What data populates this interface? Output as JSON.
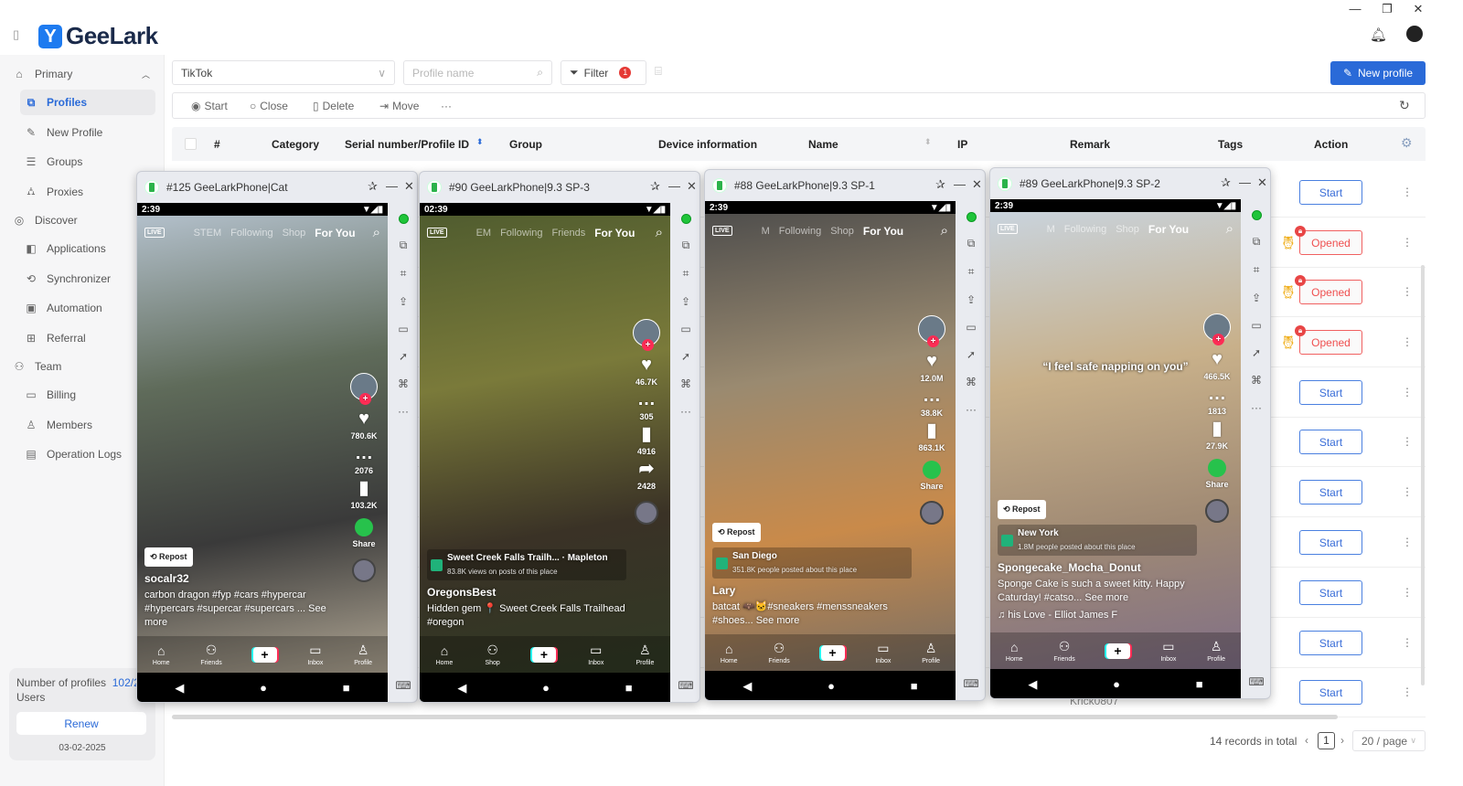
{
  "app": {
    "name": "GeeLark",
    "window_controls": [
      "—",
      "❐",
      "✕"
    ]
  },
  "sidebar": {
    "groups": [
      {
        "label": "Primary",
        "icon": "home-icon",
        "items": [
          {
            "label": "Profiles",
            "icon": "profiles-icon",
            "active": true
          },
          {
            "label": "New Profile",
            "icon": "edit-icon"
          },
          {
            "label": "Groups",
            "icon": "list-icon"
          },
          {
            "label": "Proxies",
            "icon": "proxy-icon"
          }
        ]
      },
      {
        "label": "Discover",
        "icon": "planet-icon",
        "items": [
          {
            "label": "Applications",
            "icon": "apps-icon"
          },
          {
            "label": "Synchronizer",
            "icon": "sync-icon"
          },
          {
            "label": "Automation",
            "icon": "robot-icon"
          },
          {
            "label": "Referral",
            "icon": "gift-icon"
          }
        ]
      },
      {
        "label": "Team",
        "icon": "team-icon",
        "items": [
          {
            "label": "Billing",
            "icon": "wallet-icon"
          },
          {
            "label": "Members",
            "icon": "member-icon"
          },
          {
            "label": "Operation Logs",
            "icon": "log-icon"
          }
        ]
      }
    ],
    "plan": {
      "profiles_label": "Number of profiles",
      "profiles_value": "102/2",
      "users_label": "Users",
      "renew": "Renew",
      "date": "03-02-2025"
    }
  },
  "toolbar": {
    "platform": "TikTok",
    "search_placeholder": "Profile name",
    "filter": "Filter",
    "filter_count": "1",
    "new_profile": "New profile"
  },
  "actions": [
    "Start",
    "Close",
    "Delete",
    "Move",
    "···"
  ],
  "table": {
    "columns": [
      "#",
      "Category",
      "Serial number/Profile ID",
      "Group",
      "Device information",
      "Name",
      "IP",
      "Remark",
      "Tags",
      "Action"
    ],
    "row_actions": [
      "Start",
      "Opened",
      "Opened",
      "Opened",
      "Start",
      "Start",
      "Start",
      "Start",
      "Start",
      "Start",
      "Start"
    ],
    "visible_cell": "Krick0807"
  },
  "pagination": {
    "total": "14 records in total",
    "page": "1",
    "page_size": "20 / page"
  },
  "phones": [
    {
      "title": "#125 GeeLarkPhone|Cat",
      "time": "2:39",
      "tabs": [
        "STEM",
        "Following",
        "Shop",
        "For You"
      ],
      "stats": [
        "780.6K",
        "2076",
        "103.2K",
        "Share"
      ],
      "repost": "Repost",
      "location": null,
      "username": "socalr32",
      "caption": "carbon dragon #fyp #cars #hypercar #hypercars #supercar #supercars ...  See more",
      "music": "",
      "overlay": "",
      "nav": [
        "Home",
        "Friends",
        "",
        "Inbox",
        "Profile"
      ],
      "bg": [
        "#b9c6d3",
        "#5f6b5a",
        "#3a3a3a",
        "#c7bba5"
      ]
    },
    {
      "title": "#90 GeeLarkPhone|9.3 SP-3",
      "time": "02:39",
      "tabs": [
        "EM",
        "Following",
        "Friends",
        "For You"
      ],
      "stats": [
        "46.7K",
        "305",
        "4916",
        "2428"
      ],
      "repost": "",
      "location": {
        "name": "Sweet Creek Falls Trailh... · Mapleton",
        "sub": "83.8K views on posts of this place"
      },
      "username": "OregonsBest",
      "caption": "Hidden gem 📍 Sweet Creek Falls Trailhead #oregon",
      "music": "",
      "overlay": "",
      "nav": [
        "Home",
        "Shop",
        "",
        "Inbox",
        "Profile"
      ],
      "bg": [
        "#4d5a2e",
        "#7a7a3a",
        "#3a3226",
        "#2e3a24"
      ]
    },
    {
      "title": "#88 GeeLarkPhone|9.3 SP-1",
      "time": "2:39",
      "tabs": [
        "M",
        "Following",
        "Shop",
        "For You"
      ],
      "stats": [
        "12.0M",
        "38.8K",
        "863.1K",
        "Share"
      ],
      "repost": "Repost",
      "location": {
        "name": "San Diego",
        "sub": "351.8K people posted about this place"
      },
      "username": "Lary",
      "caption": "batcat 🦇🐱#sneakers #menssneakers #shoes... See more",
      "music": "",
      "overlay": "",
      "nav": [
        "Home",
        "Friends",
        "",
        "Inbox",
        "Profile"
      ],
      "bg": [
        "#4a4a4a",
        "#9a8a70",
        "#c98a4a",
        "#6a6a6a"
      ]
    },
    {
      "title": "#89 GeeLarkPhone|9.3 SP-2",
      "time": "2:39",
      "tabs": [
        "M",
        "Following",
        "Shop",
        "For You"
      ],
      "stats": [
        "466.5K",
        "1813",
        "27.9K",
        "Share"
      ],
      "repost": "Repost",
      "location": {
        "name": "New York",
        "sub": "1.8M people posted about this place"
      },
      "username": "Spongecake_Mocha_Donut",
      "caption": "Sponge Cake is such a sweet kitty. Happy Caturday! #catso... See more",
      "music": "♫ his Love - Elliot James F",
      "overlay": "“I feel safe napping on you”",
      "nav": [
        "Home",
        "Friends",
        "",
        "Inbox",
        "Profile"
      ],
      "bg": [
        "#c9d6e3",
        "#c8b08a",
        "#a08a74",
        "#7a6a8a"
      ]
    }
  ],
  "colors": {
    "accent": "#2a6ad8",
    "danger": "#ef5050",
    "online": "#1fc43a"
  }
}
